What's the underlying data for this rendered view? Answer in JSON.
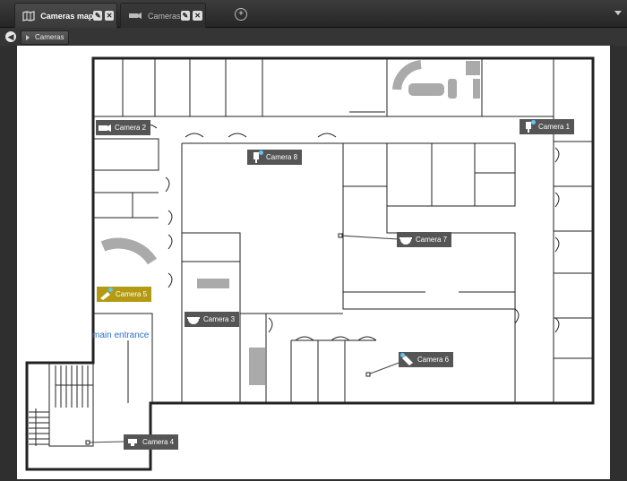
{
  "tabs": [
    {
      "label": "Cameras map",
      "icon": "map-icon",
      "active": true
    },
    {
      "label": "Cameras",
      "icon": "camera-icon",
      "active": false
    }
  ],
  "breadcrumb": {
    "back_icon": "back-arrow-icon",
    "item": "Cameras"
  },
  "map": {
    "entrance_label": "main entrance",
    "cameras": [
      {
        "name": "Camera 1",
        "icon": "box-camera-icon"
      },
      {
        "name": "Camera 2",
        "icon": "bullet-camera-icon"
      },
      {
        "name": "Camera 3",
        "icon": "dome-camera-icon"
      },
      {
        "name": "Camera 4",
        "icon": "ptz-camera-icon"
      },
      {
        "name": "Camera 5",
        "icon": "bullet-camera-icon",
        "selected": true
      },
      {
        "name": "Camera 6",
        "icon": "bullet-camera-icon"
      },
      {
        "name": "Camera 7",
        "icon": "dome-camera-icon"
      },
      {
        "name": "Camera 8",
        "icon": "box-camera-icon"
      }
    ]
  },
  "colors": {
    "selected_camera": "#b49a12",
    "camera_label": "#555555",
    "status_dot": "#5bc8f5",
    "entrance_text": "#2a6fd6"
  }
}
